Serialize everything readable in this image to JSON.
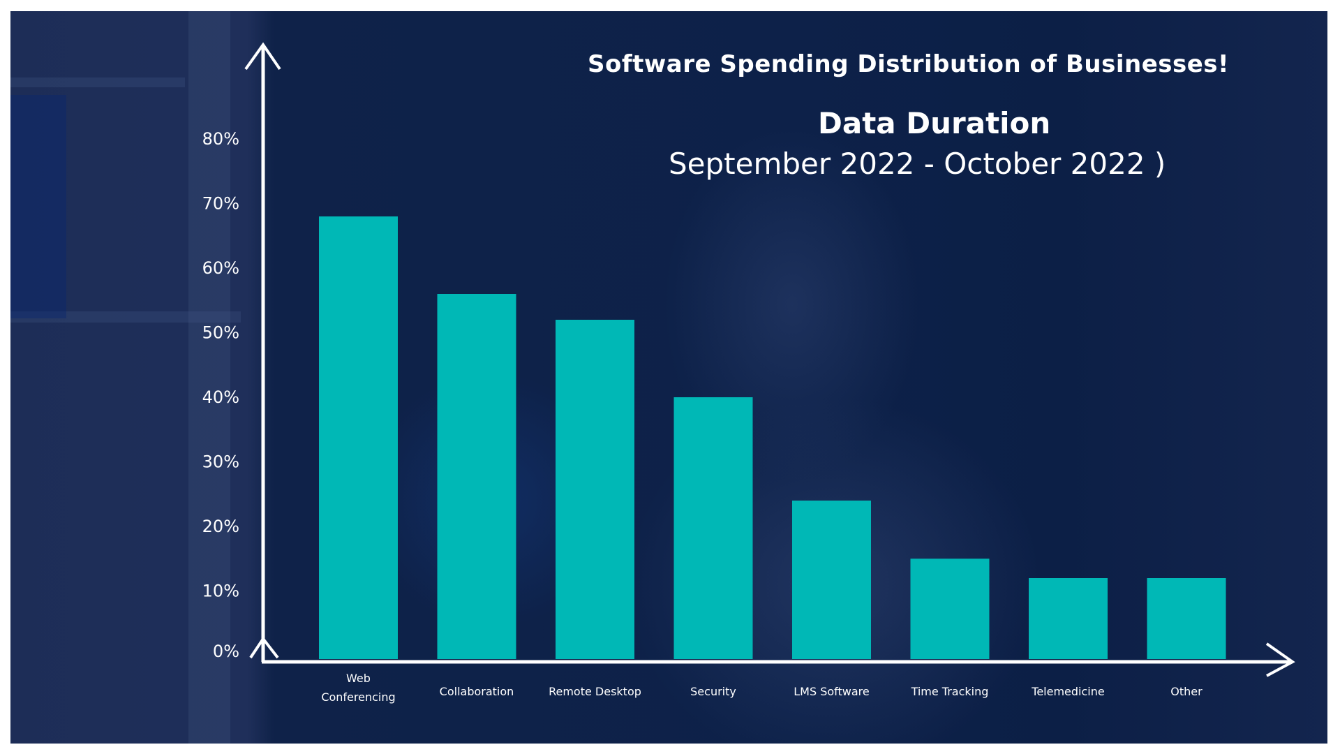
{
  "chart_data": {
    "type": "bar",
    "title": "Software Spending Distribution of Businesses!",
    "subtitle_heading": "Data Duration",
    "subtitle_range": "September 2022 - October 2022 )",
    "xlabel": "",
    "ylabel": "",
    "categories": [
      [
        "Web",
        "Conferencing"
      ],
      [
        "Collaboration"
      ],
      [
        "Remote Desktop"
      ],
      [
        "Security"
      ],
      [
        "LMS Software"
      ],
      [
        "Time Tracking"
      ],
      [
        "Telemedicine"
      ],
      [
        "Other"
      ]
    ],
    "values": [
      68,
      56,
      52,
      40,
      24,
      15,
      12,
      12
    ],
    "y_ticks": [
      "0%",
      "10%",
      "20%",
      "30%",
      "40%",
      "50%",
      "60%",
      "70%",
      "80%"
    ],
    "y_tick_values": [
      0,
      10,
      20,
      30,
      40,
      50,
      60,
      70,
      80
    ],
    "ylim": [
      0,
      80
    ],
    "grid": false,
    "legend": "none",
    "colors": {
      "bar": "#00b8b6",
      "axis": "#ffffff",
      "text": "#ffffff",
      "background": "#0d2149"
    }
  }
}
